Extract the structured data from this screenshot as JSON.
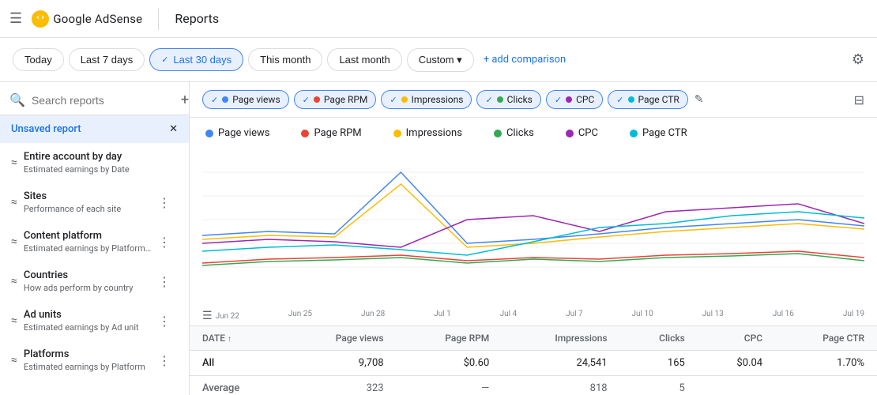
{
  "topbar": {
    "logo_text": "Google AdSense",
    "page_title": "Reports",
    "menu_icon": "☰"
  },
  "filter_bar": {
    "buttons": [
      {
        "label": "Today",
        "active": false
      },
      {
        "label": "Last 7 days",
        "active": false
      },
      {
        "label": "Last 30 days",
        "active": true
      },
      {
        "label": "This month",
        "active": false
      },
      {
        "label": "Last month",
        "active": false
      },
      {
        "label": "Custom",
        "active": false,
        "has_arrow": true
      }
    ],
    "add_comparison": "+ add comparison",
    "settings_icon": "⚙"
  },
  "sidebar": {
    "search_placeholder": "Search reports",
    "unsaved_report_label": "Unsaved report",
    "items": [
      {
        "title": "Entire account by day",
        "subtitle": "Estimated earnings by Date",
        "has_icon": true
      },
      {
        "title": "Sites",
        "subtitle": "Performance of each site",
        "has_icon": true
      },
      {
        "title": "Content platform",
        "subtitle": "Estimated earnings by Platform…",
        "has_icon": true
      },
      {
        "title": "Countries",
        "subtitle": "How ads perform by country",
        "has_icon": true
      },
      {
        "title": "Ad units",
        "subtitle": "Estimated earnings by Ad unit",
        "has_icon": true
      },
      {
        "title": "Platforms",
        "subtitle": "Estimated earnings by Platform",
        "has_icon": true
      }
    ]
  },
  "metrics": {
    "chips": [
      {
        "label": "Page views",
        "active": true,
        "color": "#4285f4"
      },
      {
        "label": "Page RPM",
        "active": true,
        "color": "#ea4335"
      },
      {
        "label": "Impressions",
        "active": true,
        "color": "#fbbc04"
      },
      {
        "label": "Clicks",
        "active": true,
        "color": "#34a853"
      },
      {
        "label": "CPC",
        "active": true,
        "color": "#9c27b0"
      },
      {
        "label": "Page CTR",
        "active": true,
        "color": "#00bcd4"
      }
    ],
    "edit_icon": "✎",
    "filter_icon": "⊟"
  },
  "legend": {
    "items": [
      {
        "label": "Page views",
        "color": "#4285f4"
      },
      {
        "label": "Page RPM",
        "color": "#ea4335"
      },
      {
        "label": "Impressions",
        "color": "#fbbc04"
      },
      {
        "label": "Clicks",
        "color": "#34a853"
      },
      {
        "label": "CPC",
        "color": "#9c27b0"
      },
      {
        "label": "Page CTR",
        "color": "#00bcd4"
      }
    ]
  },
  "chart": {
    "x_labels": [
      "Jun 22",
      "Jun 25",
      "Jun 28",
      "Jul 1",
      "Jul 4",
      "Jul 7",
      "Jul 10",
      "Jul 13",
      "Jul 16",
      "Jul 19"
    ]
  },
  "table": {
    "columns": [
      {
        "label": "DATE",
        "sort": true
      },
      {
        "label": "Page views"
      },
      {
        "label": "Page RPM"
      },
      {
        "label": "Impressions"
      },
      {
        "label": "Clicks"
      },
      {
        "label": "CPC"
      },
      {
        "label": "Page CTR"
      }
    ],
    "rows": [
      {
        "date": "All",
        "page_views": "9,708",
        "page_rpm": "$0.60",
        "impressions": "24,541",
        "clicks": "165",
        "cpc": "$0.04",
        "page_ctr": "1.70%"
      },
      {
        "date": "Average",
        "page_views": "323",
        "page_rpm": "—",
        "impressions": "818",
        "clicks": "5",
        "cpc": "",
        "page_ctr": ""
      }
    ]
  }
}
